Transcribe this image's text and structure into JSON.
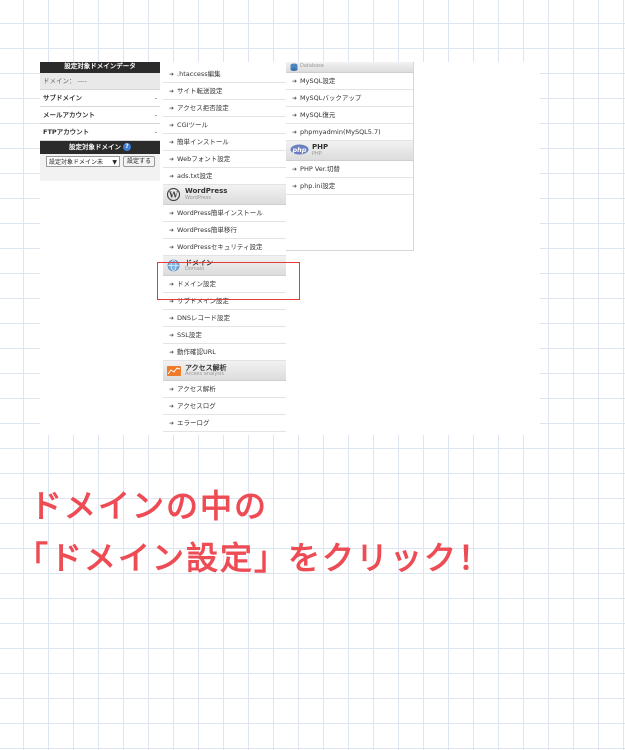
{
  "left_panel": {
    "title": "設定対象ドメインデータ",
    "rows": [
      {
        "label": "ドメイン：",
        "value": "----"
      },
      {
        "label": "サブドメイン",
        "value": "-"
      },
      {
        "label": "メールアカウント",
        "value": "-"
      },
      {
        "label": "FTPアカウント",
        "value": "-"
      }
    ],
    "target_title": "設定対象ドメイン",
    "help": "?",
    "select_value": "設定対象ドメイン未",
    "set_button": "設定する"
  },
  "col1": {
    "items_top": [
      ".htaccess編集",
      "サイト転送設定",
      "アクセス拒否設定",
      "CGIツール",
      "簡単インストール",
      "Webフォント設定",
      "ads.txt設定"
    ],
    "wordpress": {
      "title": "WordPress",
      "sub": "WordPress"
    },
    "wordpress_items": [
      "WordPress簡単インストール",
      "WordPress簡単移行",
      "WordPressセキュリティ設定"
    ],
    "domain": {
      "title": "ドメイン",
      "sub": "Domain"
    },
    "domain_items": [
      "ドメイン設定",
      "サブドメイン設定",
      "DNSレコード設定",
      "SSL設定",
      "動作確認URL"
    ],
    "access": {
      "title": "アクセス解析",
      "sub": "Access analysis"
    },
    "access_items": [
      "アクセス解析",
      "アクセスログ",
      "エラーログ"
    ]
  },
  "col2": {
    "database": {
      "sub": "Database"
    },
    "db_items": [
      "MySQL設定",
      "MySQLバックアップ",
      "MySQL復元",
      "phpmyadmin(MySQL5.7)"
    ],
    "php": {
      "title": "PHP",
      "sub": "PHP",
      "logo": "php"
    },
    "php_items": [
      "PHP Ver.切替",
      "php.ini設定"
    ]
  },
  "caption": {
    "line1": "ドメインの中の",
    "line2": "「ドメイン設定」をクリック！"
  },
  "colors": {
    "highlight": "#e23b3b",
    "caption": "#ee4c55"
  }
}
